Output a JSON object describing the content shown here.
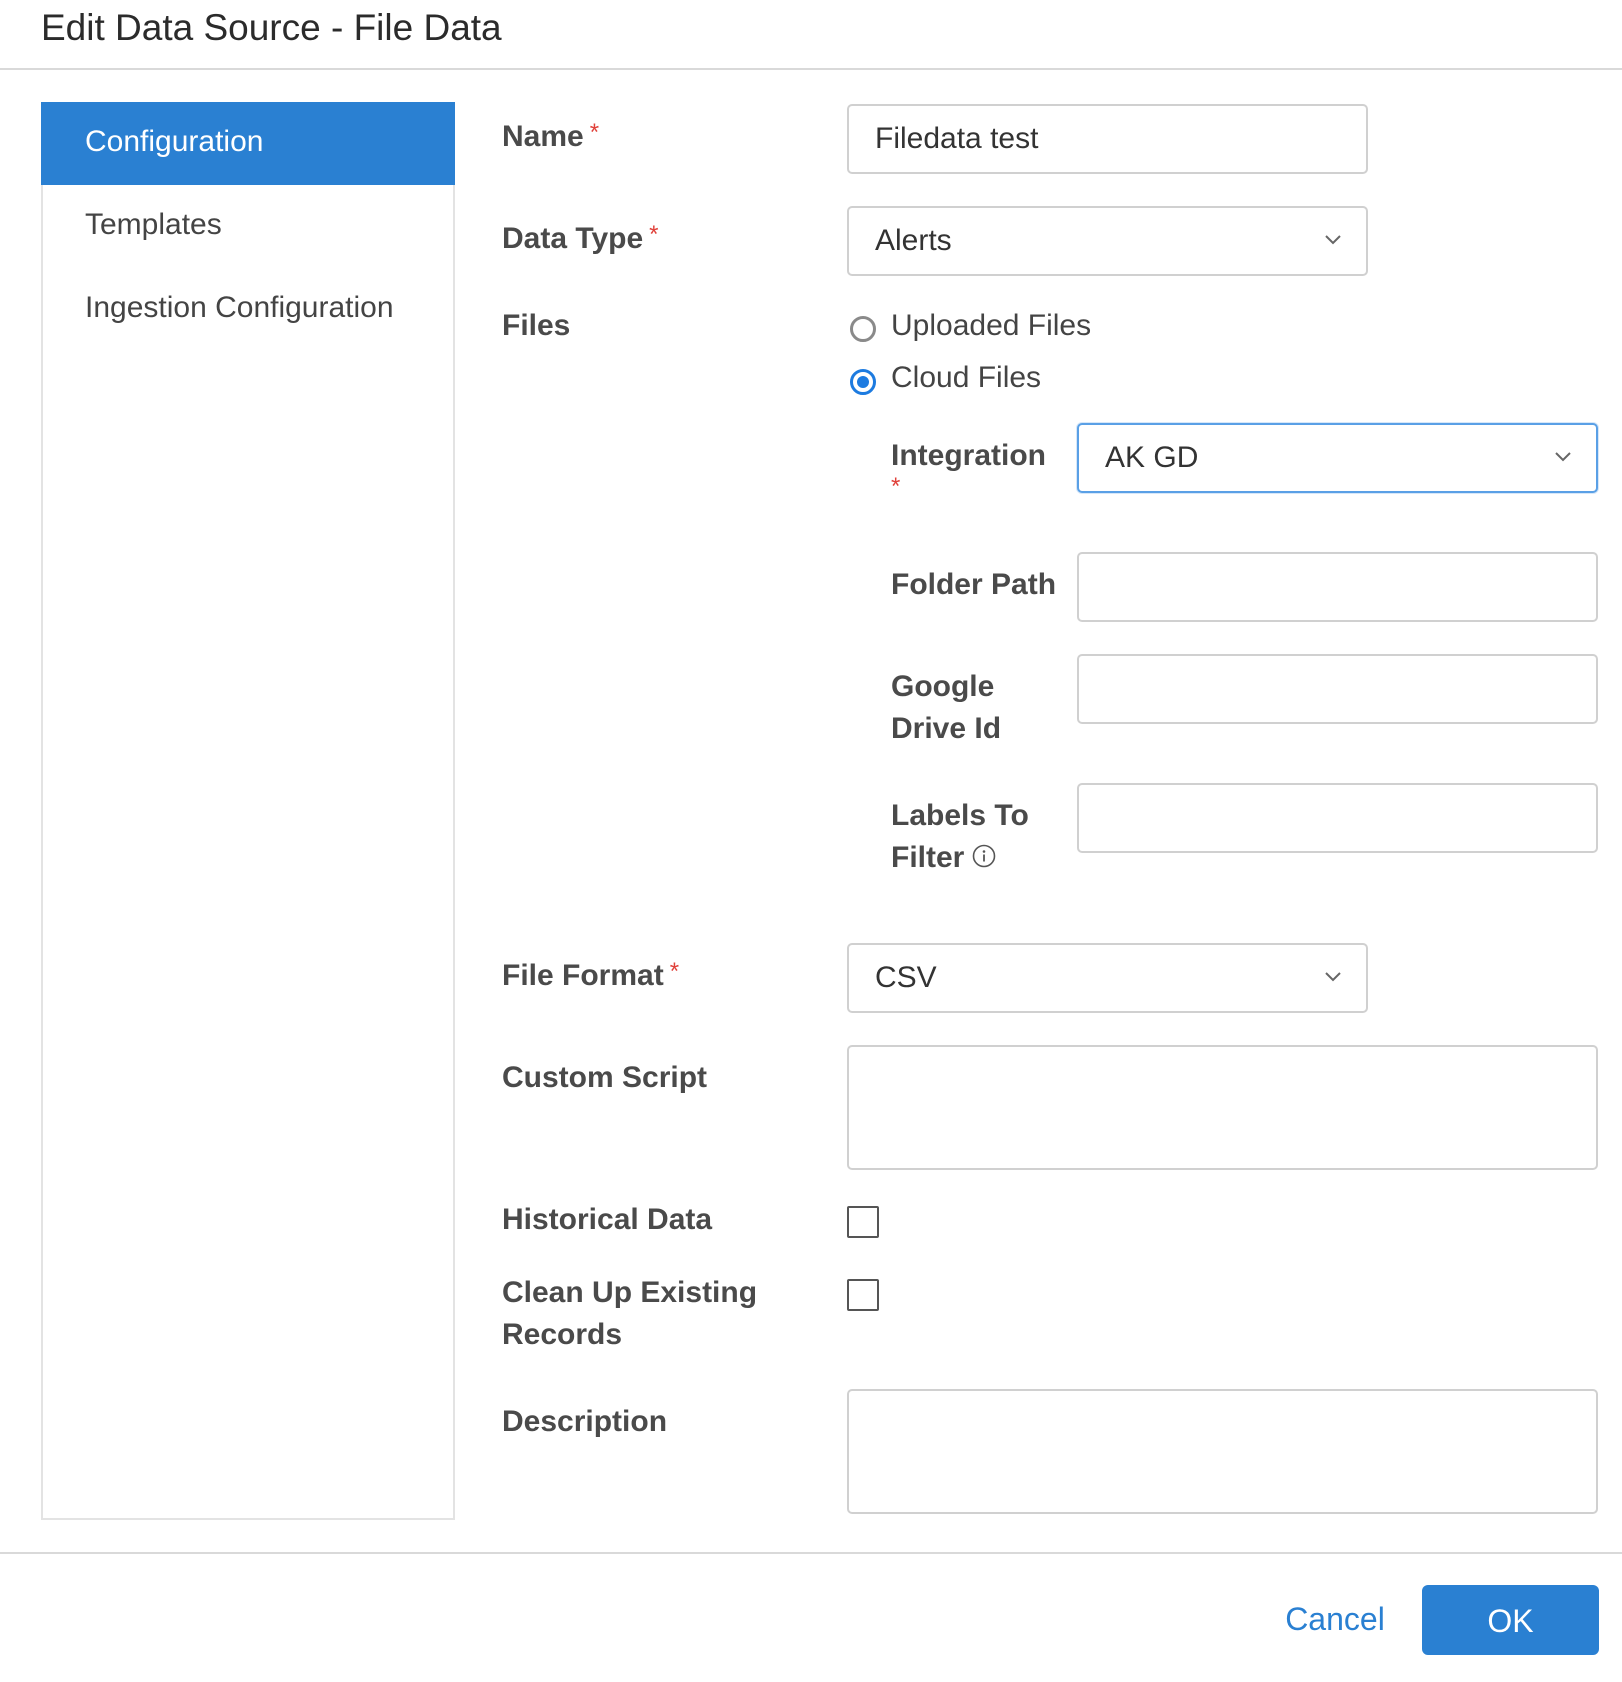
{
  "dialog": {
    "title": "Edit Data Source - File Data"
  },
  "sidebar": {
    "items": [
      {
        "label": "Configuration",
        "active": true
      },
      {
        "label": "Templates",
        "active": false
      },
      {
        "label": "Ingestion Configuration",
        "active": false
      }
    ]
  },
  "form": {
    "required_marker": "*",
    "name": {
      "label": "Name",
      "value": "Filedata test"
    },
    "data_type": {
      "label": "Data Type",
      "value": "Alerts"
    },
    "files": {
      "label": "Files",
      "options": [
        {
          "label": "Uploaded Files",
          "checked": false
        },
        {
          "label": "Cloud Files",
          "checked": true
        }
      ]
    },
    "integration": {
      "label": "Integration",
      "value": "AK GD"
    },
    "folder_path": {
      "label": "Folder Path",
      "value": ""
    },
    "google_drive_id": {
      "label_line1": "Google",
      "label_line2": "Drive Id",
      "value": ""
    },
    "labels_to_filter": {
      "label_line1": "Labels To",
      "label_line2": "Filter",
      "value": ""
    },
    "file_format": {
      "label": "File Format",
      "value": "CSV"
    },
    "custom_script": {
      "label": "Custom Script",
      "value": ""
    },
    "historical_data": {
      "label": "Historical Data",
      "checked": false
    },
    "clean_up": {
      "label_line1": "Clean Up Existing",
      "label_line2": "Records",
      "checked": false
    },
    "description": {
      "label": "Description",
      "value": ""
    }
  },
  "footer": {
    "cancel_label": "Cancel",
    "ok_label": "OK"
  },
  "colors": {
    "accent": "#2a80d2",
    "required": "#e0413a",
    "radio_checked": "#1d7be0"
  },
  "icons": {
    "select": "chevron-down-icon",
    "info": "info-icon"
  }
}
